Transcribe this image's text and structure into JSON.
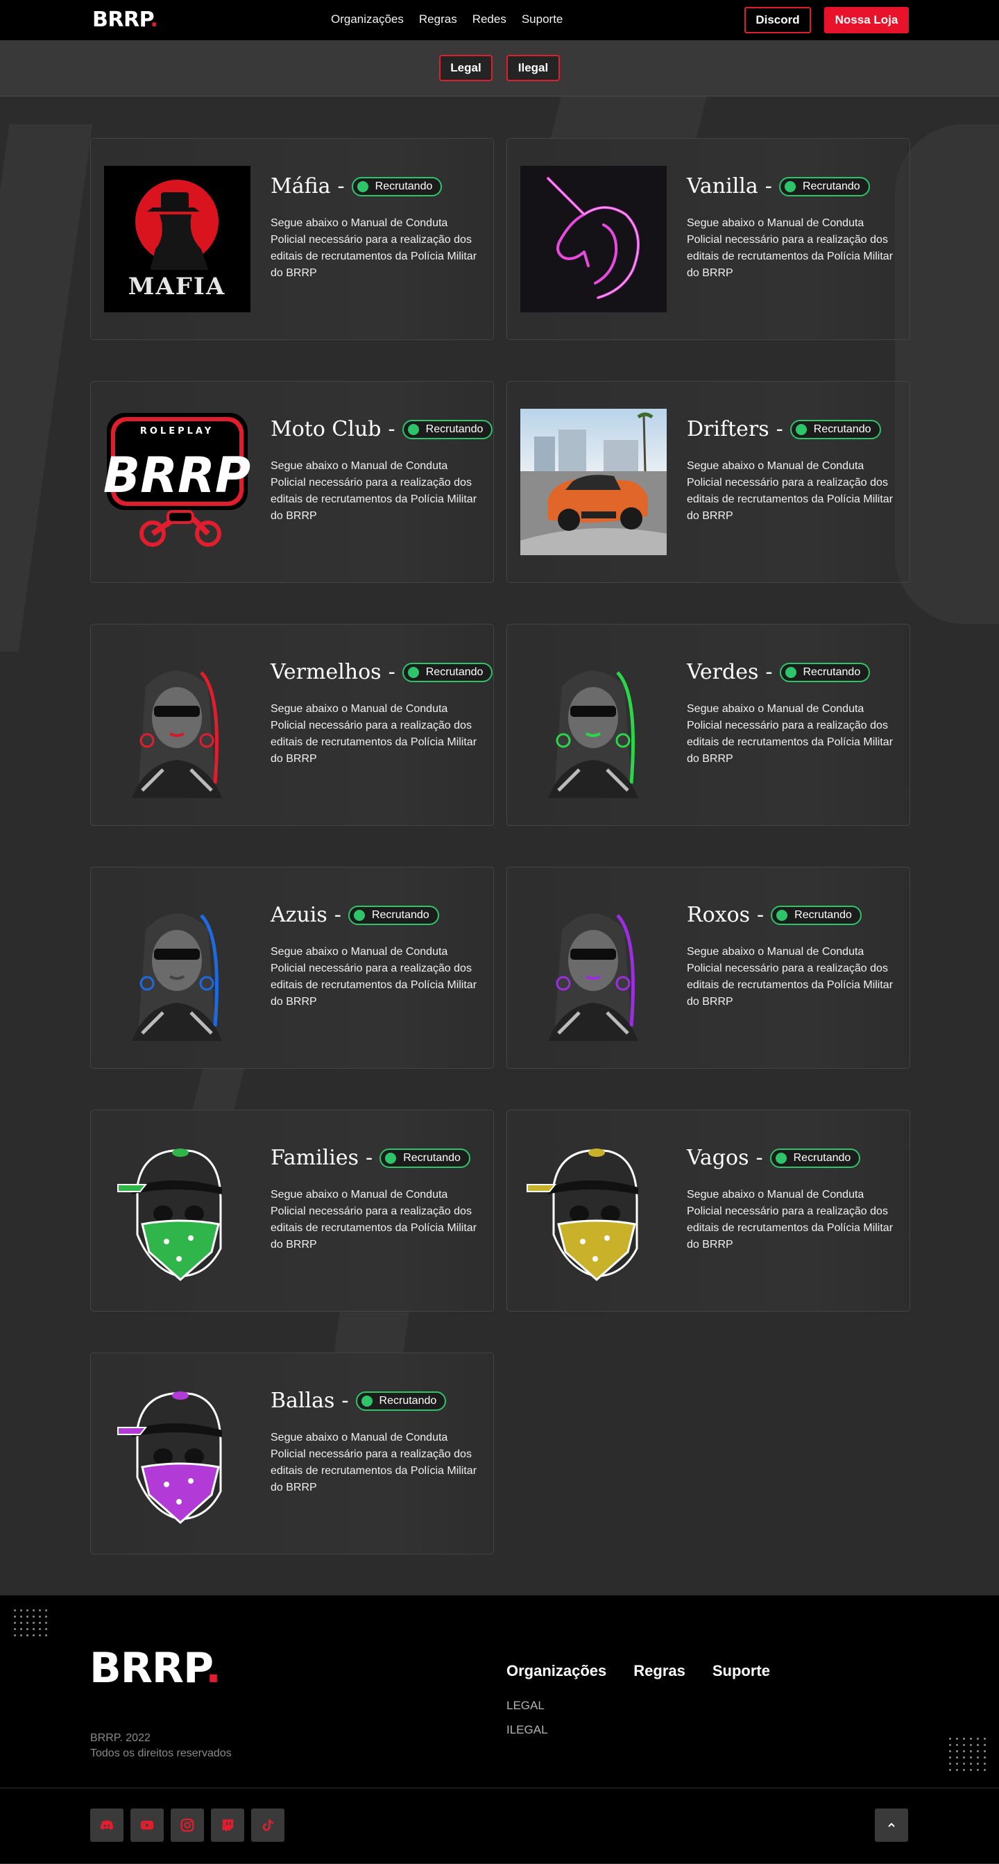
{
  "nav": {
    "brand": "BRRP",
    "brand_dot": ".",
    "links": [
      "Organizações",
      "Regras",
      "Redes",
      "Suporte"
    ],
    "discord": "Discord",
    "loja": "Nossa Loja"
  },
  "filters": {
    "legal": "Legal",
    "ilegal": "Ilegal"
  },
  "cards": [
    {
      "title": "Máfia",
      "status": "Recrutando",
      "desc": "Segue abaixo o Manual de Conduta Policial necessário para a realização dos editais de recrutamentos da Polícia Militar do BRRP",
      "image": "mafia-logo",
      "image_text": "MAFIA"
    },
    {
      "title": "Vanilla",
      "status": "Recrutando",
      "desc": "Segue abaixo o Manual de Conduta Policial necessário para a realização dos editais de recrutamentos da Polícia Militar do BRRP",
      "image": "neon-unicorn"
    },
    {
      "title": "Moto Club",
      "status": "Recrutando",
      "desc": "Segue abaixo o Manual de Conduta Policial necessário para a realização dos editais de recrutamentos da Polícia Militar do BRRP",
      "image": "brrp-motoclub-logo",
      "image_text_top": "ROLEPLAY",
      "image_text": "BRRP"
    },
    {
      "title": "Drifters",
      "status": "Recrutando",
      "desc": "Segue abaixo o Manual de Conduta Policial necessário para a realização dos editais de recrutamentos da Polícia Militar do BRRP",
      "image": "drift-car-photo"
    },
    {
      "title": "Vermelhos",
      "status": "Recrutando",
      "desc": "Segue abaixo o Manual de Conduta Policial necessário para a realização dos editais de recrutamentos da Polícia Militar do BRRP",
      "image": "gang-girl",
      "accent": "#e01e2e"
    },
    {
      "title": "Verdes",
      "status": "Recrutando",
      "desc": "Segue abaixo o Manual de Conduta Policial necessário para a realização dos editais de recrutamentos da Polícia Militar do BRRP",
      "image": "gang-girl",
      "accent": "#2bd64a"
    },
    {
      "title": "Azuis",
      "status": "Recrutando",
      "desc": "Segue abaixo o Manual de Conduta Policial necessário para a realização dos editais de recrutamentos da Polícia Militar do BRRP",
      "image": "gang-girl",
      "accent": "#1e6ae0"
    },
    {
      "title": "Roxos",
      "status": "Recrutando",
      "desc": "Segue abaixo o Manual de Conduta Policial necessário para a realização dos editais de recrutamentos da Polícia Militar do BRRP",
      "image": "gang-girl",
      "accent": "#9b2ee0"
    },
    {
      "title": "Families",
      "status": "Recrutando",
      "desc": "Segue abaixo o Manual de Conduta Policial necessário para a realização dos editais de recrutamentos da Polícia Militar do BRRP",
      "image": "skull-bandana",
      "accent": "#2fb54a"
    },
    {
      "title": "Vagos",
      "status": "Recrutando",
      "desc": "Segue abaixo o Manual de Conduta Policial necessário para a realização dos editais de recrutamentos da Polícia Militar do BRRP",
      "image": "skull-bandana",
      "accent": "#c9b22a"
    },
    {
      "title": "Ballas",
      "status": "Recrutando",
      "desc": "Segue abaixo o Manual de Conduta Policial necessário para a realização dos editais de recrutamentos da Polícia Militar do BRRP",
      "image": "skull-bandana",
      "accent": "#b23ad6"
    }
  ],
  "footer": {
    "brand": "BRRP",
    "brand_dot": ".",
    "copyright_line1": "BRRP. 2022",
    "copyright_line2": "Todos os direitos reservados",
    "nav": [
      "Organizações",
      "Regras",
      "Suporte"
    ],
    "sub_links": [
      "LEGAL",
      "ILEGAL"
    ],
    "social_icons": [
      "discord-icon",
      "youtube-icon",
      "instagram-icon",
      "twitch-icon",
      "tiktok-icon"
    ]
  },
  "colors": {
    "accent": "#e8132b",
    "status": "#2ec56a",
    "background": "#2c2c2c"
  }
}
